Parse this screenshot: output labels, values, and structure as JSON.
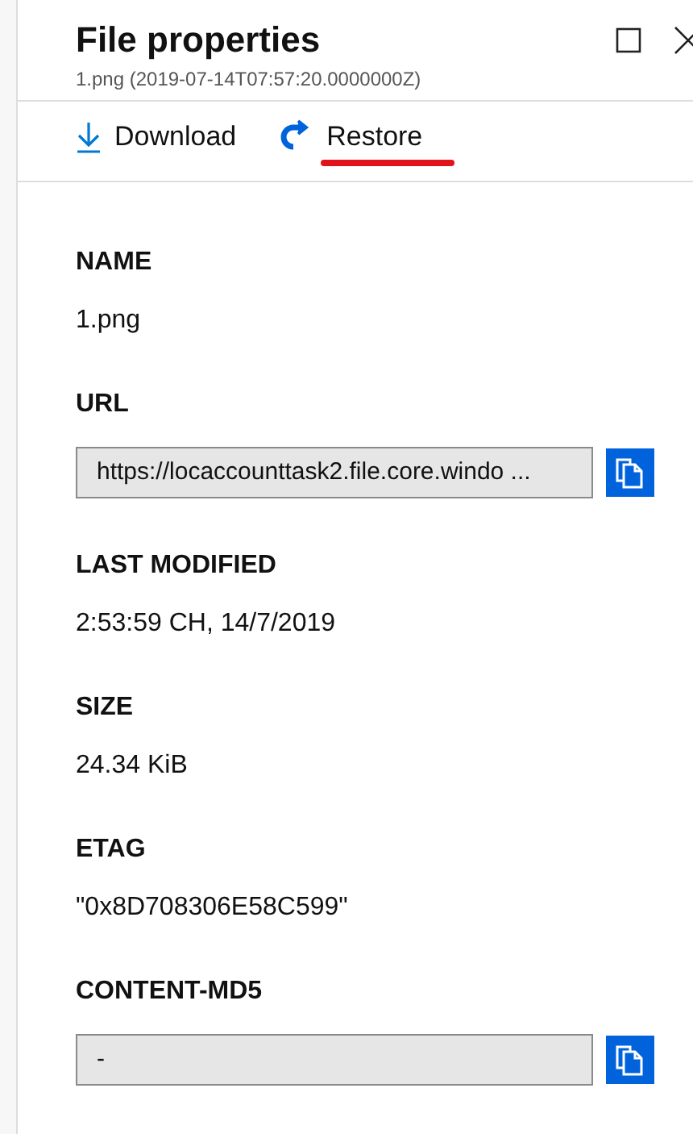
{
  "panel": {
    "title": "File properties",
    "subtitle": "1.png (2019-07-14T07:57:20.0000000Z)"
  },
  "toolbar": [
    {
      "kind": "download",
      "label": "Download",
      "highlighted": false
    },
    {
      "kind": "restore",
      "label": "Restore",
      "highlighted": true
    }
  ],
  "properties": [
    {
      "kind": "text",
      "label": "NAME",
      "value": "1.png"
    },
    {
      "kind": "field",
      "label": "URL",
      "value": "https://locaccounttask2.file.core.windo  ..."
    },
    {
      "kind": "text",
      "label": "LAST MODIFIED",
      "value": "2:53:59 CH, 14/7/2019"
    },
    {
      "kind": "text",
      "label": "SIZE",
      "value": "24.34 KiB"
    },
    {
      "kind": "text",
      "label": "ETAG",
      "value": "\"0x8D708306E58C599\""
    },
    {
      "kind": "field",
      "label": "CONTENT-MD5",
      "value": "-"
    }
  ]
}
